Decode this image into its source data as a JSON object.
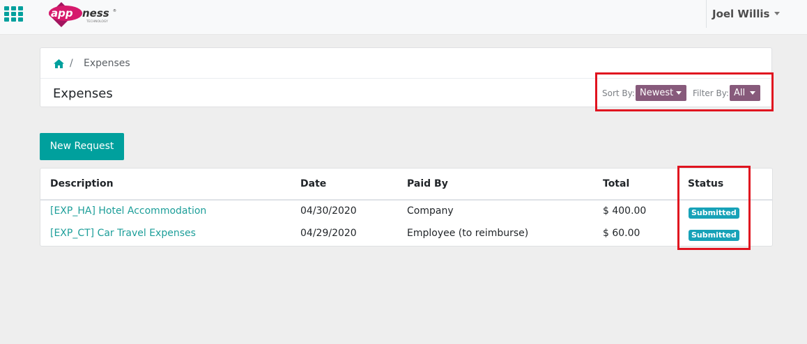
{
  "header": {
    "user_name": "Joel Willis",
    "logo": {
      "name": "appness",
      "tagline": "TECHNOLOGY"
    }
  },
  "breadcrumb": {
    "separator": "/",
    "current": "Expenses"
  },
  "page": {
    "title": "Expenses",
    "sort_label": "Sort By:",
    "sort_value": "Newest",
    "filter_label": "Filter By:",
    "filter_value": "All",
    "new_request_label": "New Request"
  },
  "table": {
    "columns": {
      "description": "Description",
      "date": "Date",
      "paid_by": "Paid By",
      "total": "Total",
      "status": "Status"
    },
    "rows": [
      {
        "description": "[EXP_HA] Hotel Accommodation",
        "date": "04/30/2020",
        "paid_by": "Company",
        "total": "$ 400.00",
        "status": "Submitted"
      },
      {
        "description": "[EXP_CT] Car Travel Expenses",
        "date": "04/29/2020",
        "paid_by": "Employee (to reimburse)",
        "total": "$ 60.00",
        "status": "Submitted"
      }
    ]
  },
  "colors": {
    "primary": "#00a09d",
    "dropdown": "#875a7b",
    "badge": "#17a2b8",
    "link": "#1c9e99",
    "highlight": "#e0131f"
  }
}
